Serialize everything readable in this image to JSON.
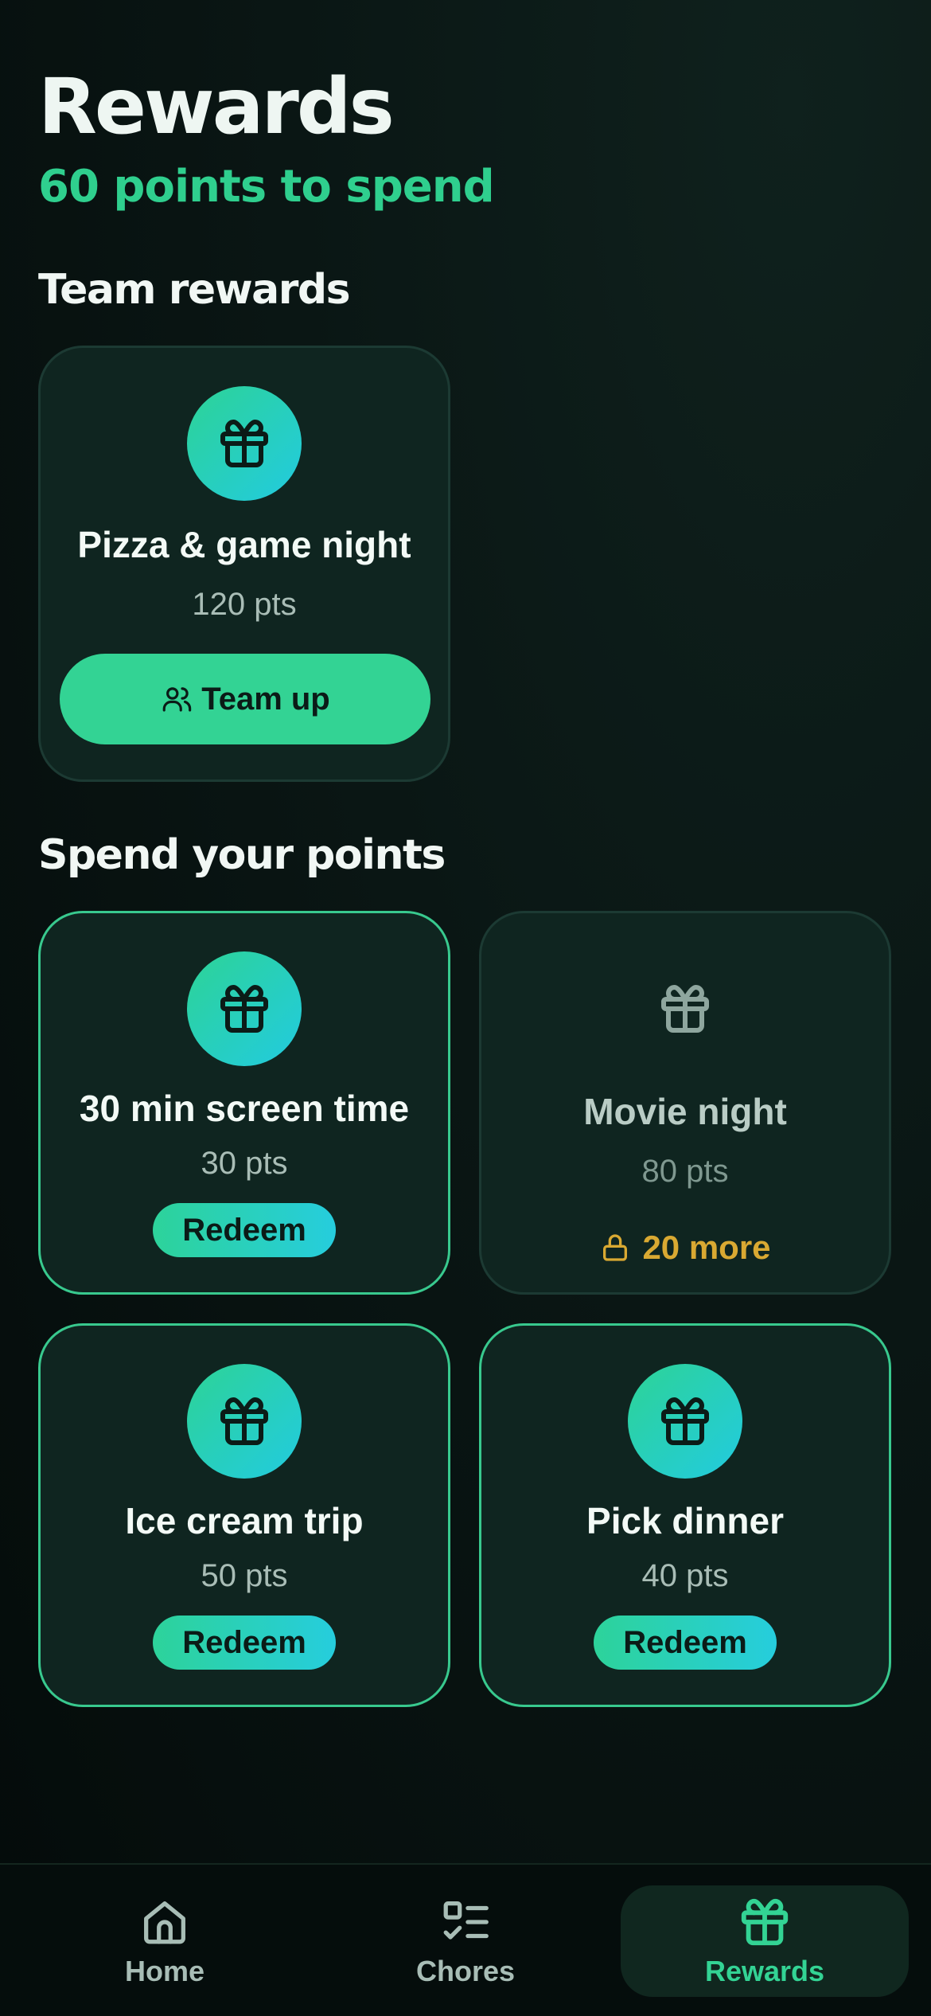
{
  "header": {
    "title": "Rewards",
    "points_summary": "60 points to spend"
  },
  "team_section": {
    "title": "Team rewards",
    "cards": [
      {
        "name": "Pizza & game night",
        "points": "120 pts",
        "action_label": "Team up",
        "icon": "gift-icon"
      }
    ]
  },
  "spend_section": {
    "title": "Spend your points",
    "cards": [
      {
        "name": "30 min screen time",
        "points": "30 pts",
        "action_label": "Redeem",
        "state": "available",
        "icon": "gift-icon"
      },
      {
        "name": "Movie night",
        "points": "80 pts",
        "locked_label": "20 more",
        "state": "locked",
        "icon": "gift-icon"
      },
      {
        "name": "Ice cream trip",
        "points": "50 pts",
        "action_label": "Redeem",
        "state": "available",
        "icon": "gift-icon"
      },
      {
        "name": "Pick dinner",
        "points": "40 pts",
        "action_label": "Redeem",
        "state": "available",
        "icon": "gift-icon"
      }
    ]
  },
  "tabbar": {
    "items": [
      {
        "label": "Home",
        "icon": "home-icon"
      },
      {
        "label": "Chores",
        "icon": "checklist-icon"
      },
      {
        "label": "Rewards",
        "icon": "gift-icon",
        "active": true
      }
    ]
  },
  "colors": {
    "accent": "#33d394",
    "accent_cyan": "#22cbe0",
    "warning": "#d9a932",
    "background": "#0a1614",
    "card": "#0f2520"
  }
}
